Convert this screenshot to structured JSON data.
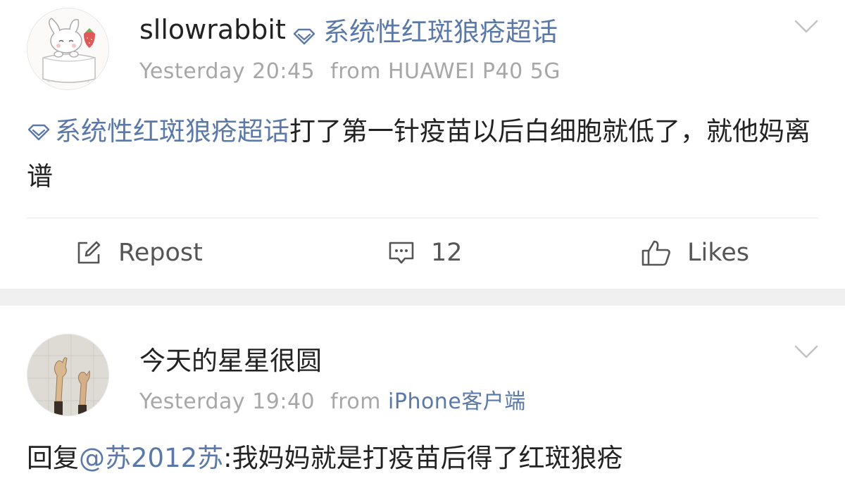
{
  "posts": [
    {
      "username": "sllowrabbit",
      "supertopic": "系统性红斑狼疮超话",
      "time": "Yesterday 20:45",
      "source": "from HUAWEI P40 5G",
      "content_tag": "系统性红斑狼疮超话",
      "content_text": "打了第一针疫苗以后白细胞就低了，就他妈离谱",
      "actions": {
        "repost_label": "Repost",
        "comment_count": "12",
        "like_label": "Likes"
      }
    },
    {
      "username": "今天的星星很圆",
      "time": "Yesterday 19:40",
      "source_prefix": "from",
      "source_client": "iPhone客户端",
      "reply_prefix": "回复",
      "mention": "@苏2012苏",
      "reply_text": ":我妈妈就是打疫苗后得了红斑狼疮"
    }
  ],
  "icons": {
    "supertopic": "diamond-icon",
    "menu": "chevron-down-icon",
    "repost": "edit-icon",
    "comment": "comment-icon",
    "like": "thumbs-up-icon"
  },
  "colors": {
    "link": "#5b79a8",
    "meta": "#a7a7a7",
    "text": "#222222",
    "separator": "#f0f0f0"
  }
}
